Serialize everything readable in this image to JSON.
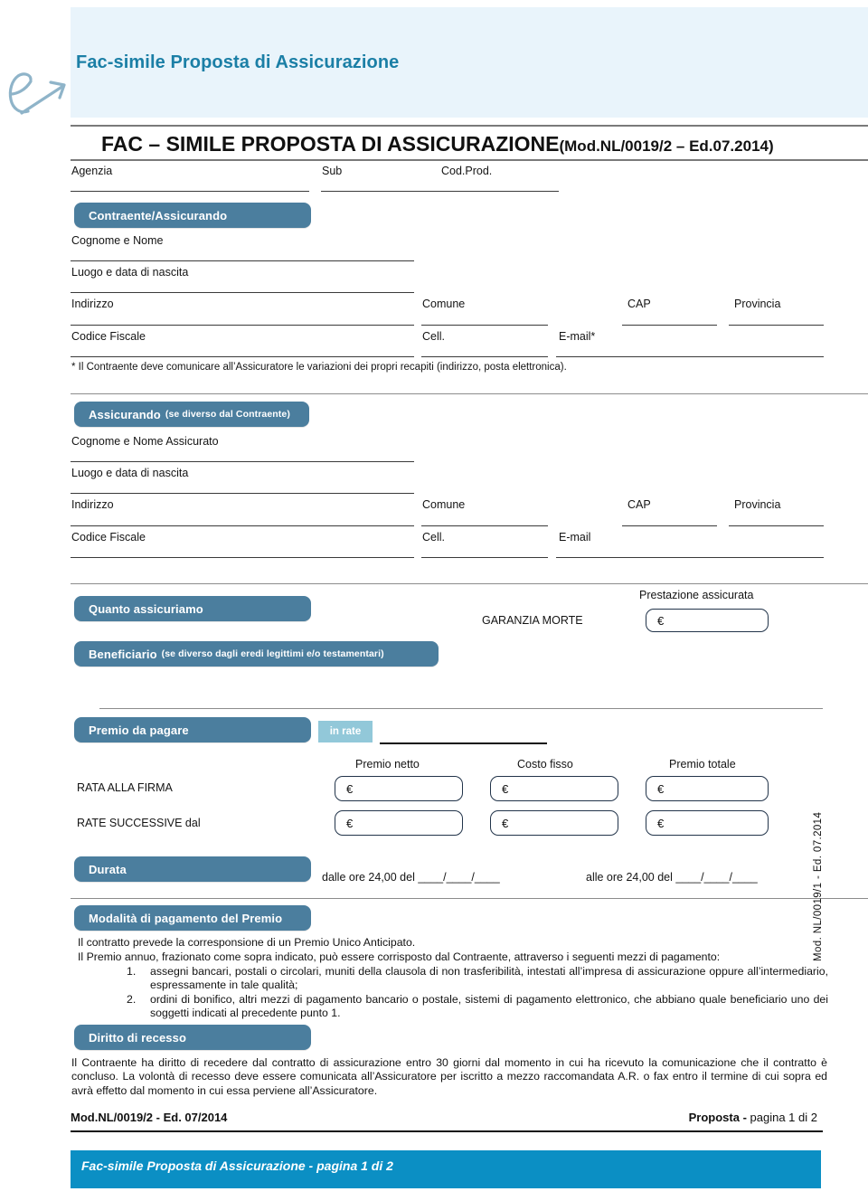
{
  "banner": {
    "title": "Fac-simile Proposta di Assicurazione",
    "logo_icon": "e-arrow-logo",
    "bg_color": "#e9f4fb",
    "text_color": "#1b7fa6"
  },
  "document": {
    "title_main": "FAC – SIMILE PROPOSTA DI ASSICURAZIONE",
    "title_code": "(Mod.NL/0019/2 – Ed.07.2014)"
  },
  "agency_row": {
    "agenzia": "Agenzia",
    "sub": "Sub",
    "cod_prod": "Cod.Prod."
  },
  "contraente": {
    "badge": "Contraente/Assicurando",
    "cognome_nome": "Cognome e Nome",
    "luogo_data": "Luogo e data di nascita",
    "indirizzo": "Indirizzo",
    "comune": "Comune",
    "cap": "CAP",
    "provincia": "Provincia",
    "codice_fiscale": "Codice Fiscale",
    "cell": "Cell.",
    "email": "E-mail*",
    "footnote": "* Il Contraente deve comunicare all’Assicuratore le variazioni dei propri recapiti (indirizzo, posta elettronica)."
  },
  "assicurando": {
    "badge": "Assicurando",
    "badge_sub": "(se diverso dal Contraente)",
    "cognome_nome": "Cognome e Nome Assicurato",
    "luogo_data": "Luogo e data di nascita",
    "indirizzo": "Indirizzo",
    "comune": "Comune",
    "cap": "CAP",
    "provincia": "Provincia",
    "codice_fiscale": "Codice Fiscale",
    "cell": "Cell.",
    "email": "E-mail"
  },
  "quanto_assicuriamo": {
    "badge": "Quanto assicuriamo",
    "garanzia_label": "GARANZIA MORTE",
    "prestazione_label": "Prestazione assicurata",
    "prestazione_value": "€"
  },
  "beneficiario": {
    "badge": "Beneficiario",
    "badge_sub": "(se diverso dagli eredi legittimi e/o testamentari)"
  },
  "premio": {
    "badge": "Premio da pagare",
    "in_rate": "in rate",
    "in_rate_value": "",
    "col_netto": "Premio netto",
    "col_fisso": "Costo fisso",
    "col_totale": "Premio totale",
    "rows": [
      {
        "label": "RATA ALLA FIRMA",
        "netto": "€",
        "fisso": "€",
        "totale": "€"
      },
      {
        "label": "RATE SUCCESSIVE dal",
        "netto": "€",
        "fisso": "€",
        "totale": "€"
      }
    ]
  },
  "durata": {
    "badge": "Durata",
    "dalle": "dalle ore 24,00 del ____/____/____",
    "alle": "alle ore 24,00 del ____/____/____"
  },
  "modalita": {
    "badge": "Modalità di pagamento del Premio",
    "p1": "Il contratto prevede la corresponsione di un Premio Unico Anticipato.",
    "p2": "Il Premio annuo, frazionato come sopra indicato, può essere corrisposto dal Contraente, attraverso i seguenti mezzi di pagamento:",
    "items": [
      {
        "num": "1.",
        "text": "assegni bancari, postali o circolari, muniti della clausola di non trasferibilità, intestati all’impresa di assicurazione oppure all’intermediario, espressamente in tale qualità;"
      },
      {
        "num": "2.",
        "text": "ordini di bonifico, altri mezzi di pagamento bancario o postale, sistemi di pagamento elettronico, che abbiano quale beneficiario uno dei soggetti indicati al precedente punto 1."
      }
    ]
  },
  "recesso": {
    "badge": "Diritto di recesso",
    "text": "Il Contraente ha diritto di recedere dal contratto di assicurazione entro 30 giorni dal momento in cui ha ricevuto la comunicazione che il contratto è concluso. La volontà di recesso deve essere comunicata all’Assicuratore per iscritto a mezzo raccomandata A.R. o fax entro il termine di cui sopra ed avrà effetto dal momento in cui essa perviene all’Assicuratore."
  },
  "footer": {
    "mod": "Mod.NL/0019/2 - Ed. 07/2014",
    "page_bold": "Proposta -",
    "page_rest": " pagina 1 di 2",
    "bar_text": "Fac-simile Proposta di Assicurazione  - pagina 1 di 2",
    "bar_color": "#0b8fc4",
    "side_text": "Mod. NL/0019/1 - Ed. 07.2014"
  },
  "colors": {
    "badge_blue": "#4b7e9e",
    "badge_light_blue": "#92c8d9",
    "banner_blue": "#e9f4fb",
    "accent_teal": "#1b7fa6",
    "footer_blue": "#0b8fc4",
    "input_border": "#22344a"
  }
}
